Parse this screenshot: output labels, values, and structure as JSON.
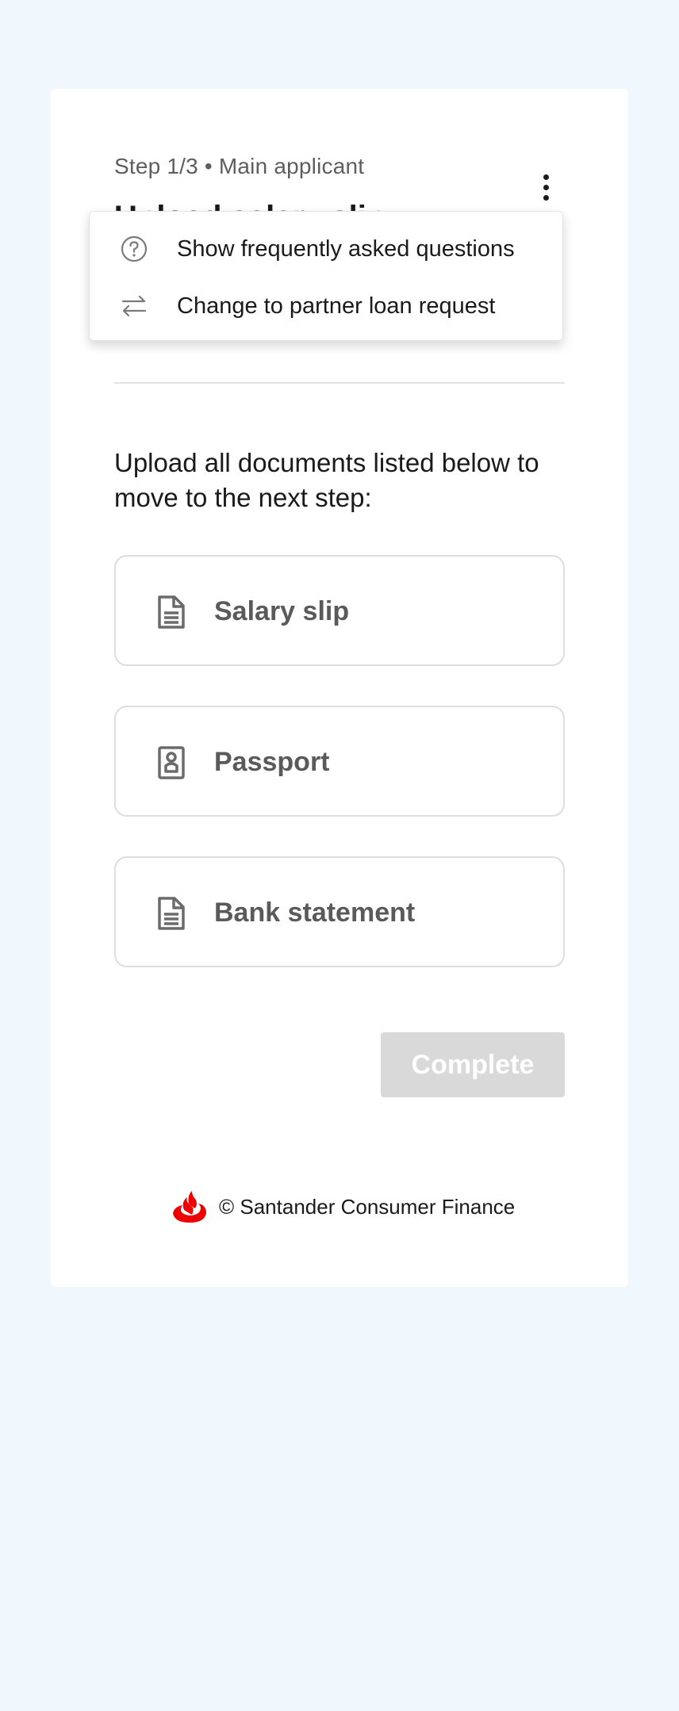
{
  "header": {
    "step_label": "Step 1/3 • Main applicant",
    "page_title": "Upload salary slip"
  },
  "menu": {
    "items": [
      {
        "label": "Show frequently asked questions",
        "icon": "help-circle-icon"
      },
      {
        "label": "Change to partner loan request",
        "icon": "swap-arrows-icon"
      }
    ]
  },
  "main": {
    "intro": "Upload all documents listed below to move to the next step:",
    "documents": [
      {
        "label": "Salary slip",
        "icon": "document-icon"
      },
      {
        "label": "Passport",
        "icon": "passport-icon"
      },
      {
        "label": "Bank statement",
        "icon": "document-icon"
      }
    ],
    "complete_label": "Complete"
  },
  "footer": {
    "text": "© Santander Consumer Finance",
    "logo": "santander-flame-logo"
  },
  "colors": {
    "background": "#f0f7fd",
    "brand_red": "#ec0000",
    "disabled_button": "#d9d9d9",
    "icon_gray": "#6b6b6b"
  }
}
